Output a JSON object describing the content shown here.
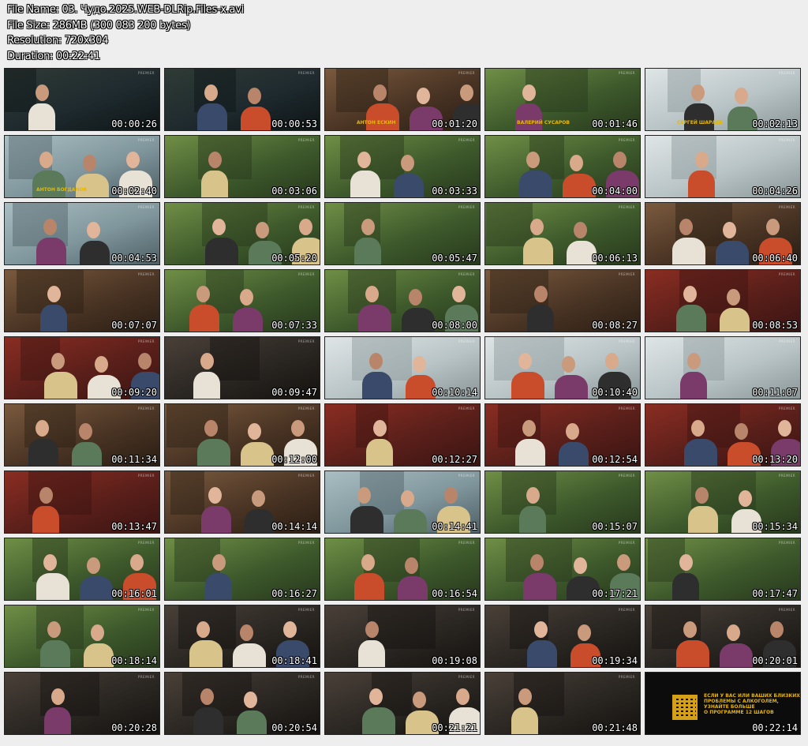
{
  "header": {
    "file_name": "File Name: 03. Чудо.2025.WEB-DLRip.Files-x.avi",
    "file_size": "File Size: 286MB (300 083 200 bytes)",
    "resolution": "Resolution: 720x304",
    "duration": "Duration: 00:22:41"
  },
  "watermark": "PREMIER",
  "thumbnails": [
    {
      "time": "00:00:26",
      "scene": "night-street"
    },
    {
      "time": "00:00:53",
      "scene": "night-man"
    },
    {
      "time": "00:01:20",
      "scene": "man-carpet",
      "caption": "АНТОН ЕСКИН"
    },
    {
      "time": "00:01:46",
      "scene": "kick-grass",
      "caption": "ВАЛЕРИЙ СУСАРОВ"
    },
    {
      "time": "00:02:13",
      "scene": "bald-bed",
      "caption": "СЕРГЕЙ ШАРАЕВ"
    },
    {
      "time": "00:02:40",
      "scene": "hospital-room",
      "caption": "АНТОН БОГДАНОВ"
    },
    {
      "time": "00:03:06",
      "scene": "park-walk"
    },
    {
      "time": "00:03:33",
      "scene": "workers"
    },
    {
      "time": "00:04:00",
      "scene": "workers2"
    },
    {
      "time": "00:04:26",
      "scene": "bald-pillow"
    },
    {
      "time": "00:04:53",
      "scene": "ward"
    },
    {
      "time": "00:05:20",
      "scene": "stadium"
    },
    {
      "time": "00:05:47",
      "scene": "stadium2"
    },
    {
      "time": "00:06:13",
      "scene": "bald-green"
    },
    {
      "time": "00:06:40",
      "scene": "woman-room"
    },
    {
      "time": "00:07:07",
      "scene": "car-window"
    },
    {
      "time": "00:07:33",
      "scene": "yard"
    },
    {
      "time": "00:08:00",
      "scene": "yard2"
    },
    {
      "time": "00:08:27",
      "scene": "room-people"
    },
    {
      "time": "00:08:53",
      "scene": "room-red"
    },
    {
      "time": "00:09:20",
      "scene": "room-red2"
    },
    {
      "time": "00:09:47",
      "scene": "closeup"
    },
    {
      "time": "00:10:14",
      "scene": "white-room"
    },
    {
      "time": "00:10:40",
      "scene": "bed-top"
    },
    {
      "time": "00:11:07",
      "scene": "corridor"
    },
    {
      "time": "00:11:34",
      "scene": "girl-manage"
    },
    {
      "time": "00:12:00",
      "scene": "girl-manage2"
    },
    {
      "time": "00:12:27",
      "scene": "red-room"
    },
    {
      "time": "00:12:54",
      "scene": "red-room2"
    },
    {
      "time": "00:13:20",
      "scene": "red-room3"
    },
    {
      "time": "00:13:47",
      "scene": "red-room4"
    },
    {
      "time": "00:14:14",
      "scene": "kitchen"
    },
    {
      "time": "00:14:41",
      "scene": "bus"
    },
    {
      "time": "00:15:07",
      "scene": "ambulance"
    },
    {
      "time": "00:15:34",
      "scene": "ambulance2"
    },
    {
      "time": "00:16:01",
      "scene": "park-man"
    },
    {
      "time": "00:16:27",
      "scene": "park-man2"
    },
    {
      "time": "00:16:54",
      "scene": "park-women"
    },
    {
      "time": "00:17:21",
      "scene": "park-group"
    },
    {
      "time": "00:17:47",
      "scene": "park-woman"
    },
    {
      "time": "00:18:14",
      "scene": "tree-women"
    },
    {
      "time": "00:18:41",
      "scene": "document"
    },
    {
      "time": "00:19:08",
      "scene": "hall"
    },
    {
      "time": "00:19:34",
      "scene": "old-man"
    },
    {
      "time": "00:20:01",
      "scene": "hall-couple"
    },
    {
      "time": "00:20:28",
      "scene": "hall-couple2"
    },
    {
      "time": "00:20:54",
      "scene": "dark-people"
    },
    {
      "time": "00:21:21",
      "scene": "dark-people2"
    },
    {
      "time": "00:21:48",
      "scene": "portrait"
    },
    {
      "time": "00:22:14",
      "scene": "ad",
      "ad_text": [
        "ЕСЛИ У ВАС ИЛИ ВАШИХ БЛИЗКИХ",
        "ПРОБЛЕМЫ С АЛКОГОЛЕМ,",
        "УЗНАЙТЕ БОЛЬШЕ",
        "О ПРОГРАММЕ 12 ШАГОВ"
      ]
    }
  ]
}
